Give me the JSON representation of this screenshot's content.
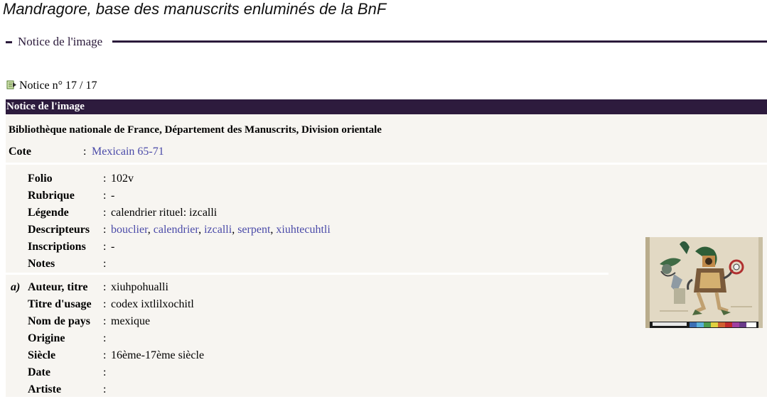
{
  "site_title": "Mandragore, base des manuscrits enluminés de la BnF",
  "section_legend": "Notice de l'image",
  "notice_counter": "Notice n° 17 / 17",
  "panel_header": "Notice de l'image",
  "library": "Bibliothèque nationale de France, Département des Manuscrits, Division orientale",
  "cote": {
    "label": "Cote",
    "colon": ":",
    "value": "Mexicain 65-71"
  },
  "image_fields": [
    {
      "label": "Folio",
      "value": "102v"
    },
    {
      "label": "Rubrique",
      "value": "-"
    },
    {
      "label": "Légende",
      "value": "calendrier rituel: izcalli"
    },
    {
      "label": "Descripteurs",
      "links": [
        "bouclier",
        "calendrier",
        "izcalli",
        "serpent",
        "xiuhtecuhtli"
      ],
      "separator": ", "
    },
    {
      "label": "Inscriptions",
      "value": "-"
    },
    {
      "label": "Notes",
      "value": ""
    }
  ],
  "manuscript": {
    "marker": "a)",
    "fields": [
      {
        "label": "Auteur, titre",
        "value": "xiuhpohualli"
      },
      {
        "label": "Titre d'usage",
        "value": "codex ixtlilxochitl"
      },
      {
        "label": "Nom de pays",
        "value": "mexique"
      },
      {
        "label": "Origine",
        "value": ""
      },
      {
        "label": "Siècle",
        "value": "16ème-17ème siècle"
      },
      {
        "label": "Date",
        "value": ""
      },
      {
        "label": "Artiste",
        "value": ""
      }
    ]
  },
  "colors": {
    "header_bg": "#2d1b3d",
    "link": "#4a4aa8",
    "panel_bg": "#f7f5f1"
  },
  "icons": {
    "notice_icon": "document-arrow-icon"
  }
}
